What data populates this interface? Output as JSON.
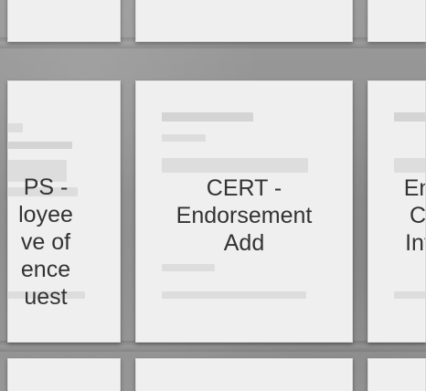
{
  "cards": {
    "left": {
      "lines": [
        "PS -",
        "loyee",
        "ve of",
        "ence",
        "uest"
      ]
    },
    "center": {
      "lines": [
        "CERT -",
        "Endorsement",
        "Add"
      ]
    },
    "right": {
      "lines": [
        "En",
        "C",
        "Inf"
      ]
    }
  }
}
